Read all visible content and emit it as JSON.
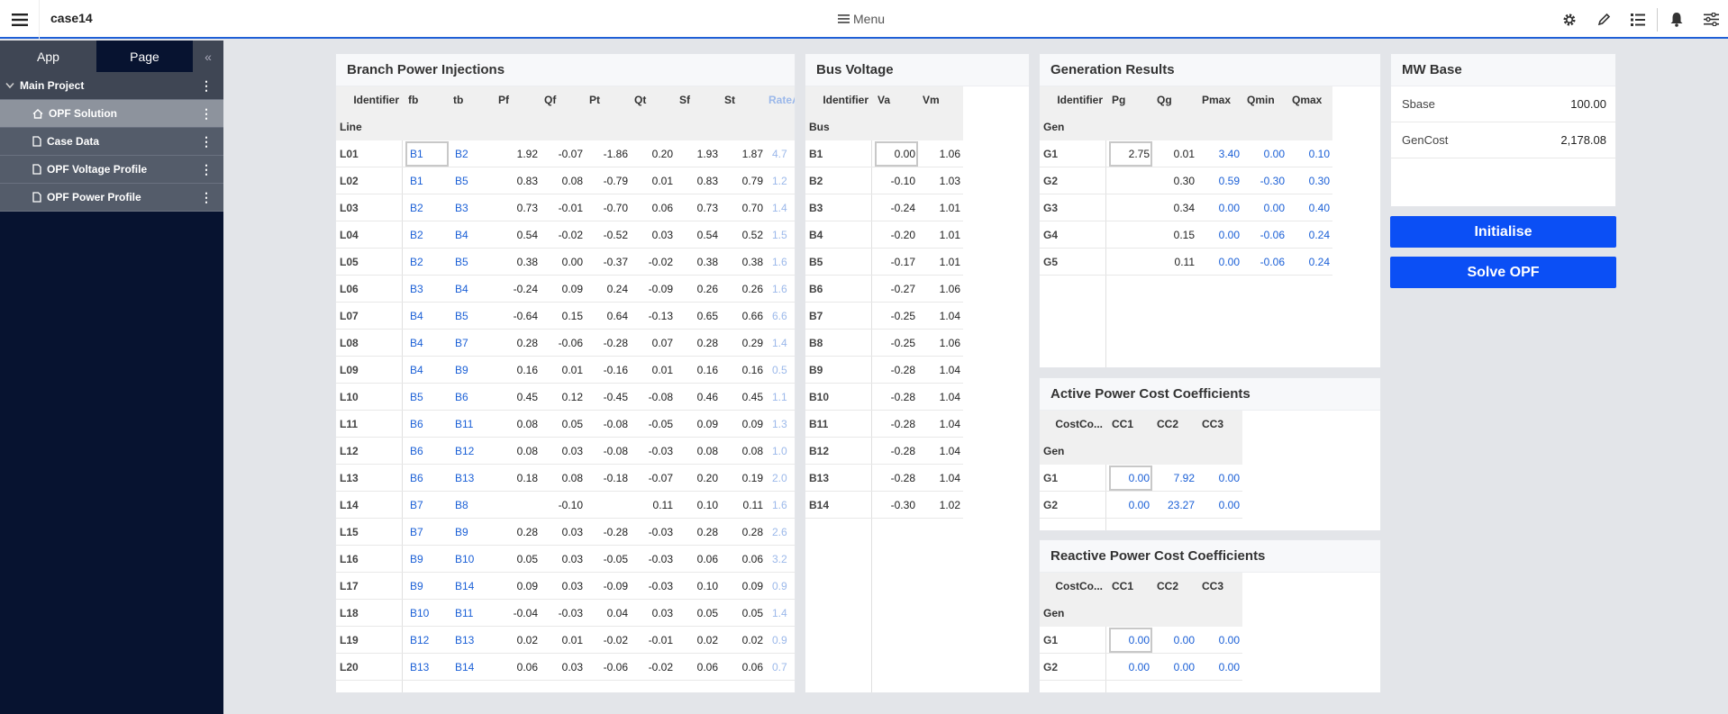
{
  "app_title": "case14",
  "menu_label": "Menu",
  "sidebar": {
    "tabs": [
      "App",
      "Page"
    ],
    "project": "Main Project",
    "items": [
      "OPF Solution",
      "Case Data",
      "OPF Voltage Profile",
      "OPF Power Profile"
    ]
  },
  "branch": {
    "title": "Branch Power Injections",
    "id_header": "Identifier",
    "id_sub": "Line",
    "columns": [
      "fb",
      "tb",
      "Pf",
      "Qf",
      "Pt",
      "Qt",
      "Sf",
      "St",
      "RateA"
    ],
    "rows": [
      [
        "L01",
        "B1",
        "B2",
        "1.92",
        "-0.07",
        "-1.86",
        "0.20",
        "1.93",
        "1.87",
        "4.7"
      ],
      [
        "L02",
        "B1",
        "B5",
        "0.83",
        "0.08",
        "-0.79",
        "0.01",
        "0.83",
        "0.79",
        "1.2"
      ],
      [
        "L03",
        "B2",
        "B3",
        "0.73",
        "-0.01",
        "-0.70",
        "0.06",
        "0.73",
        "0.70",
        "1.4"
      ],
      [
        "L04",
        "B2",
        "B4",
        "0.54",
        "-0.02",
        "-0.52",
        "0.03",
        "0.54",
        "0.52",
        "1.5"
      ],
      [
        "L05",
        "B2",
        "B5",
        "0.38",
        "0.00",
        "-0.37",
        "-0.02",
        "0.38",
        "0.38",
        "1.6"
      ],
      [
        "L06",
        "B3",
        "B4",
        "-0.24",
        "0.09",
        "0.24",
        "-0.09",
        "0.26",
        "0.26",
        "1.6"
      ],
      [
        "L07",
        "B4",
        "B5",
        "-0.64",
        "0.15",
        "0.64",
        "-0.13",
        "0.65",
        "0.66",
        "6.6"
      ],
      [
        "L08",
        "B4",
        "B7",
        "0.28",
        "-0.06",
        "-0.28",
        "0.07",
        "0.28",
        "0.29",
        "1.4"
      ],
      [
        "L09",
        "B4",
        "B9",
        "0.16",
        "0.01",
        "-0.16",
        "0.01",
        "0.16",
        "0.16",
        "0.5"
      ],
      [
        "L10",
        "B5",
        "B6",
        "0.45",
        "0.12",
        "-0.45",
        "-0.08",
        "0.46",
        "0.45",
        "1.1"
      ],
      [
        "L11",
        "B6",
        "B11",
        "0.08",
        "0.05",
        "-0.08",
        "-0.05",
        "0.09",
        "0.09",
        "1.3"
      ],
      [
        "L12",
        "B6",
        "B12",
        "0.08",
        "0.03",
        "-0.08",
        "-0.03",
        "0.08",
        "0.08",
        "1.0"
      ],
      [
        "L13",
        "B6",
        "B13",
        "0.18",
        "0.08",
        "-0.18",
        "-0.07",
        "0.20",
        "0.19",
        "2.0"
      ],
      [
        "L14",
        "B7",
        "B8",
        "",
        "-0.10",
        "",
        "0.11",
        "0.10",
        "0.11",
        "1.6"
      ],
      [
        "L15",
        "B7",
        "B9",
        "0.28",
        "0.03",
        "-0.28",
        "-0.03",
        "0.28",
        "0.28",
        "2.6"
      ],
      [
        "L16",
        "B9",
        "B10",
        "0.05",
        "0.03",
        "-0.05",
        "-0.03",
        "0.06",
        "0.06",
        "3.2"
      ],
      [
        "L17",
        "B9",
        "B14",
        "0.09",
        "0.03",
        "-0.09",
        "-0.03",
        "0.10",
        "0.09",
        "0.9"
      ],
      [
        "L18",
        "B10",
        "B11",
        "-0.04",
        "-0.03",
        "0.04",
        "0.03",
        "0.05",
        "0.05",
        "1.4"
      ],
      [
        "L19",
        "B12",
        "B13",
        "0.02",
        "0.01",
        "-0.02",
        "-0.01",
        "0.02",
        "0.02",
        "0.9"
      ],
      [
        "L20",
        "B13",
        "B14",
        "0.06",
        "0.03",
        "-0.06",
        "-0.02",
        "0.06",
        "0.06",
        "0.7"
      ]
    ]
  },
  "bus": {
    "title": "Bus Voltage",
    "id_header": "Identifier",
    "id_sub": "Bus",
    "columns": [
      "Va",
      "Vm"
    ],
    "rows": [
      [
        "B1",
        "0.00",
        "1.06"
      ],
      [
        "B2",
        "-0.10",
        "1.03"
      ],
      [
        "B3",
        "-0.24",
        "1.01"
      ],
      [
        "B4",
        "-0.20",
        "1.01"
      ],
      [
        "B5",
        "-0.17",
        "1.01"
      ],
      [
        "B6",
        "-0.27",
        "1.06"
      ],
      [
        "B7",
        "-0.25",
        "1.04"
      ],
      [
        "B8",
        "-0.25",
        "1.06"
      ],
      [
        "B9",
        "-0.28",
        "1.04"
      ],
      [
        "B10",
        "-0.28",
        "1.04"
      ],
      [
        "B11",
        "-0.28",
        "1.04"
      ],
      [
        "B12",
        "-0.28",
        "1.04"
      ],
      [
        "B13",
        "-0.28",
        "1.04"
      ],
      [
        "B14",
        "-0.30",
        "1.02"
      ]
    ]
  },
  "gen": {
    "title": "Generation Results",
    "id_header": "Identifier",
    "id_sub": "Gen",
    "columns": [
      "Pg",
      "Qg",
      "Pmax",
      "Qmin",
      "Qmax"
    ],
    "rows": [
      [
        "G1",
        "2.75",
        "0.01",
        "3.40",
        "0.00",
        "0.10"
      ],
      [
        "G2",
        "",
        "0.30",
        "0.59",
        "-0.30",
        "0.30"
      ],
      [
        "G3",
        "",
        "0.34",
        "0.00",
        "0.00",
        "0.40"
      ],
      [
        "G4",
        "",
        "0.15",
        "0.00",
        "-0.06",
        "0.24"
      ],
      [
        "G5",
        "",
        "0.11",
        "0.00",
        "-0.06",
        "0.24"
      ]
    ]
  },
  "active_cost": {
    "title": "Active Power Cost Coefficients",
    "id_header": "CostCo...",
    "id_sub": "Gen",
    "columns": [
      "CC1",
      "CC2",
      "CC3"
    ],
    "rows": [
      [
        "G1",
        "0.00",
        "7.92",
        "0.00"
      ],
      [
        "G2",
        "0.00",
        "23.27",
        "0.00"
      ]
    ]
  },
  "reactive_cost": {
    "title": "Reactive Power Cost Coefficients",
    "id_header": "CostCo...",
    "id_sub": "Gen",
    "columns": [
      "CC1",
      "CC2",
      "CC3"
    ],
    "rows": [
      [
        "G1",
        "0.00",
        "0.00",
        "0.00"
      ],
      [
        "G2",
        "0.00",
        "0.00",
        "0.00"
      ]
    ]
  },
  "mwbase": {
    "title": "MW Base",
    "rows": [
      [
        "Sbase",
        "100.00"
      ],
      [
        "GenCost",
        "2,178.08"
      ]
    ]
  },
  "buttons": {
    "initialise": "Initialise",
    "solve": "Solve OPF"
  }
}
